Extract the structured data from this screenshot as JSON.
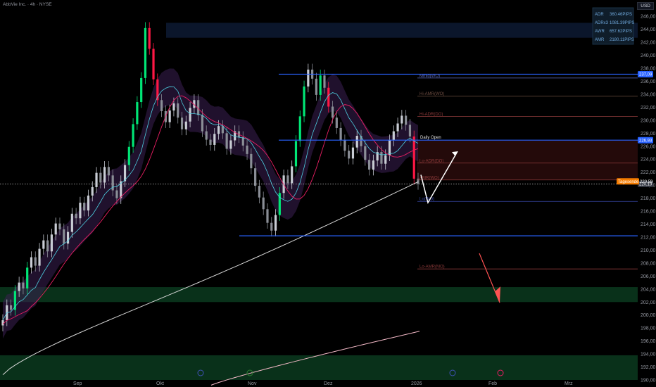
{
  "header": {
    "title": "AbbVie Inc. · 4h · NYSE",
    "currency": "USD"
  },
  "stats_table": [
    {
      "label": "ADR",
      "value": "360.46PIPS"
    },
    {
      "label": "ADRx3",
      "value": "1081.39PIPS"
    },
    {
      "label": "AWR",
      "value": "657.62PIPS"
    },
    {
      "label": "AMR",
      "value": "2180.11PIPS"
    }
  ],
  "colors": {
    "up_candle": "#26a69a",
    "down_candle": "#ef5350",
    "strong_up": "#00e676",
    "strong_down": "#ff1744",
    "blue_line": "#2962ff",
    "ma_white": "#d8d8d8",
    "ma_pink": "#f2b8c6",
    "ma_teal": "#4dd0e1",
    "ma_red": "#e91e63",
    "zone_green": "#0b3a1f",
    "zone_red": "#2a0c0c"
  },
  "chart_data": {
    "type": "candlestick",
    "symbol": "AbbVie Inc.",
    "timeframe": "4h",
    "exchange": "NYSE",
    "ylim": [
      190,
      247
    ],
    "y_ticks": [
      "246,00",
      "244,00",
      "242,00",
      "240,00",
      "238,00",
      "236,00",
      "234,00",
      "232,00",
      "230,00",
      "228,00",
      "226,00",
      "224,00",
      "222,00",
      "220,00",
      "218,00",
      "216,00",
      "214,00",
      "212,00",
      "210,00",
      "208,00",
      "206,00",
      "204,00",
      "202,00",
      "200,00",
      "198,00",
      "196,00",
      "194,00",
      "192,00",
      "190,00"
    ],
    "x_ticks": [
      "Sep",
      "Okt",
      "Nov",
      "Dez",
      "2026",
      "Feb",
      "Mrz"
    ],
    "price_labels": [
      {
        "text": "237,09",
        "value": 237.09,
        "color": "#2962ff"
      },
      {
        "text": "226,93",
        "value": 226.93,
        "color": "#2962ff"
      },
      {
        "text": "220,19",
        "value": 220.19,
        "color": "#363a45"
      },
      {
        "text": "Tagesende 220,59",
        "value": 220.59,
        "color": "#f57c00"
      }
    ],
    "levels": [
      {
        "label": "Mmid(WO)",
        "value": 236.5,
        "color": "#5c6bc0"
      },
      {
        "label": "Hi-AMR(WO)",
        "value": 233.7,
        "color": "#6d4c41"
      },
      {
        "label": "Hi-ADR(DO)",
        "value": 230.6,
        "color": "#8d3a3a"
      },
      {
        "label": "Daily Open",
        "value": 226.93,
        "color": "#2962ff"
      },
      {
        "label": "Lo-ADR(DO)",
        "value": 223.4,
        "color": "#8d3a3a"
      },
      {
        "label": "AMR(WO)",
        "value": 220.8,
        "color": "#8d3a3a"
      },
      {
        "label": "Lo(WO)",
        "value": 217.5,
        "color": "#3949ab"
      },
      {
        "label": "Lo-AMR(MO)",
        "value": 207.1,
        "color": "#8d3a3a"
      }
    ],
    "horizontal_lines": [
      237.09,
      226.93,
      212.2
    ],
    "dotted_price_line": 220.19,
    "zones": [
      {
        "from": 242.7,
        "to": 245.0,
        "kind": "blue"
      },
      {
        "from": 220.8,
        "to": 226.93,
        "kind": "red"
      },
      {
        "from": 202.0,
        "to": 204.3,
        "kind": "green"
      },
      {
        "from": 190.0,
        "to": 193.8,
        "kind": "green"
      }
    ],
    "close_series": [
      199.2,
      201.5,
      200.8,
      203.7,
      205.0,
      204.1,
      207.3,
      208.9,
      207.6,
      210.2,
      211.5,
      209.8,
      212.4,
      214.1,
      213.2,
      211.0,
      212.8,
      215.6,
      214.9,
      217.3,
      216.1,
      218.4,
      219.7,
      221.9,
      220.4,
      222.8,
      221.5,
      219.2,
      218.0,
      220.6,
      223.1,
      225.9,
      229.4,
      232.8,
      236.5,
      244.2,
      241.0,
      236.3,
      233.1,
      231.4,
      229.7,
      231.5,
      232.6,
      230.4,
      228.6,
      229.8,
      231.9,
      233.1,
      230.8,
      228.3,
      227.0,
      226.2,
      227.9,
      229.1,
      228.0,
      225.6,
      226.9,
      228.3,
      227.4,
      226.1,
      224.8,
      222.6,
      219.9,
      218.1,
      216.3,
      214.2,
      213.0,
      215.4,
      218.8,
      221.5,
      220.3,
      222.9,
      226.8,
      230.6,
      235.2,
      237.8,
      236.4,
      233.9,
      236.9,
      235.0,
      232.1,
      230.4,
      228.8,
      226.9,
      225.3,
      224.1,
      225.8,
      227.6,
      226.0,
      223.9,
      222.4,
      223.8,
      225.1,
      223.3,
      224.6,
      226.9,
      228.3,
      229.5,
      230.7,
      229.3,
      227.5,
      221.0,
      220.2
    ],
    "trend_arrows": [
      {
        "points": [
          [
            219.3,
            "turn"
          ],
          [
            224.6,
            "up"
          ]
        ],
        "color": "#ffffff"
      },
      {
        "direction": "down",
        "color": "#ff5252"
      }
    ]
  }
}
